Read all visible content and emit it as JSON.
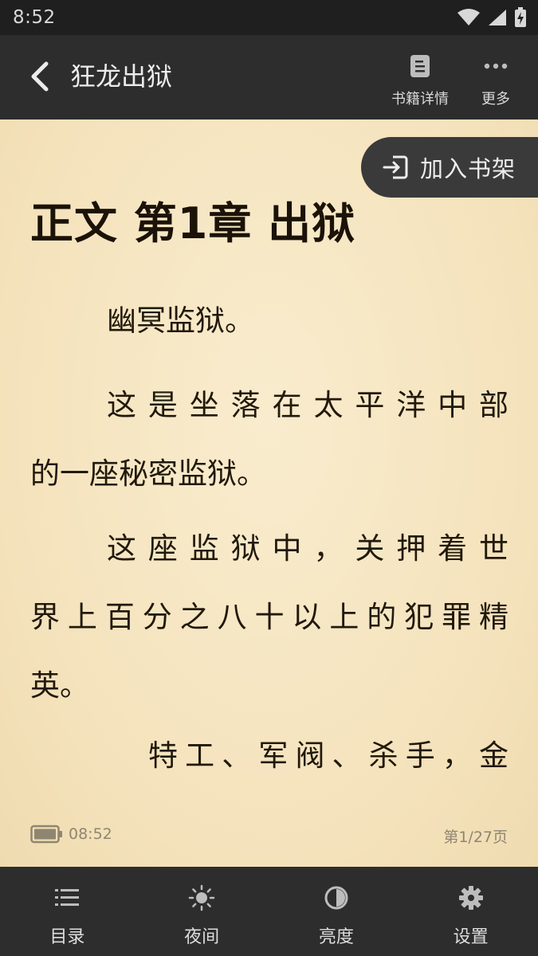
{
  "status_bar": {
    "time": "8:52"
  },
  "header": {
    "title": "狂龙出狱",
    "actions": [
      {
        "label": "书籍详情",
        "icon": "document-icon"
      },
      {
        "label": "更多",
        "icon": "more-dots-icon"
      }
    ]
  },
  "reader": {
    "add_to_shelf_label": "加入书架",
    "chapter_title": "正文 第1章 出狱",
    "paragraphs": [
      [
        "幽冥监狱。"
      ],
      [
        "这是坐落在太平洋中部",
        "的一座秘密监狱。"
      ],
      [
        "这座监狱中，关押着世",
        "界上百分之八十以上的犯罪精",
        "英。"
      ],
      [
        "特工、军阀、杀手，金"
      ]
    ],
    "footer": {
      "time": "08:52",
      "page": "第1/27页"
    }
  },
  "bottom_nav": [
    {
      "label": "目录",
      "icon": "list-icon"
    },
    {
      "label": "夜间",
      "icon": "sun-icon"
    },
    {
      "label": "亮度",
      "icon": "contrast-icon"
    },
    {
      "label": "设置",
      "icon": "gear-icon"
    }
  ],
  "colors": {
    "bar_background": "#2d2d2d",
    "page_background": "#f6e7c4",
    "text": "#21190c"
  }
}
